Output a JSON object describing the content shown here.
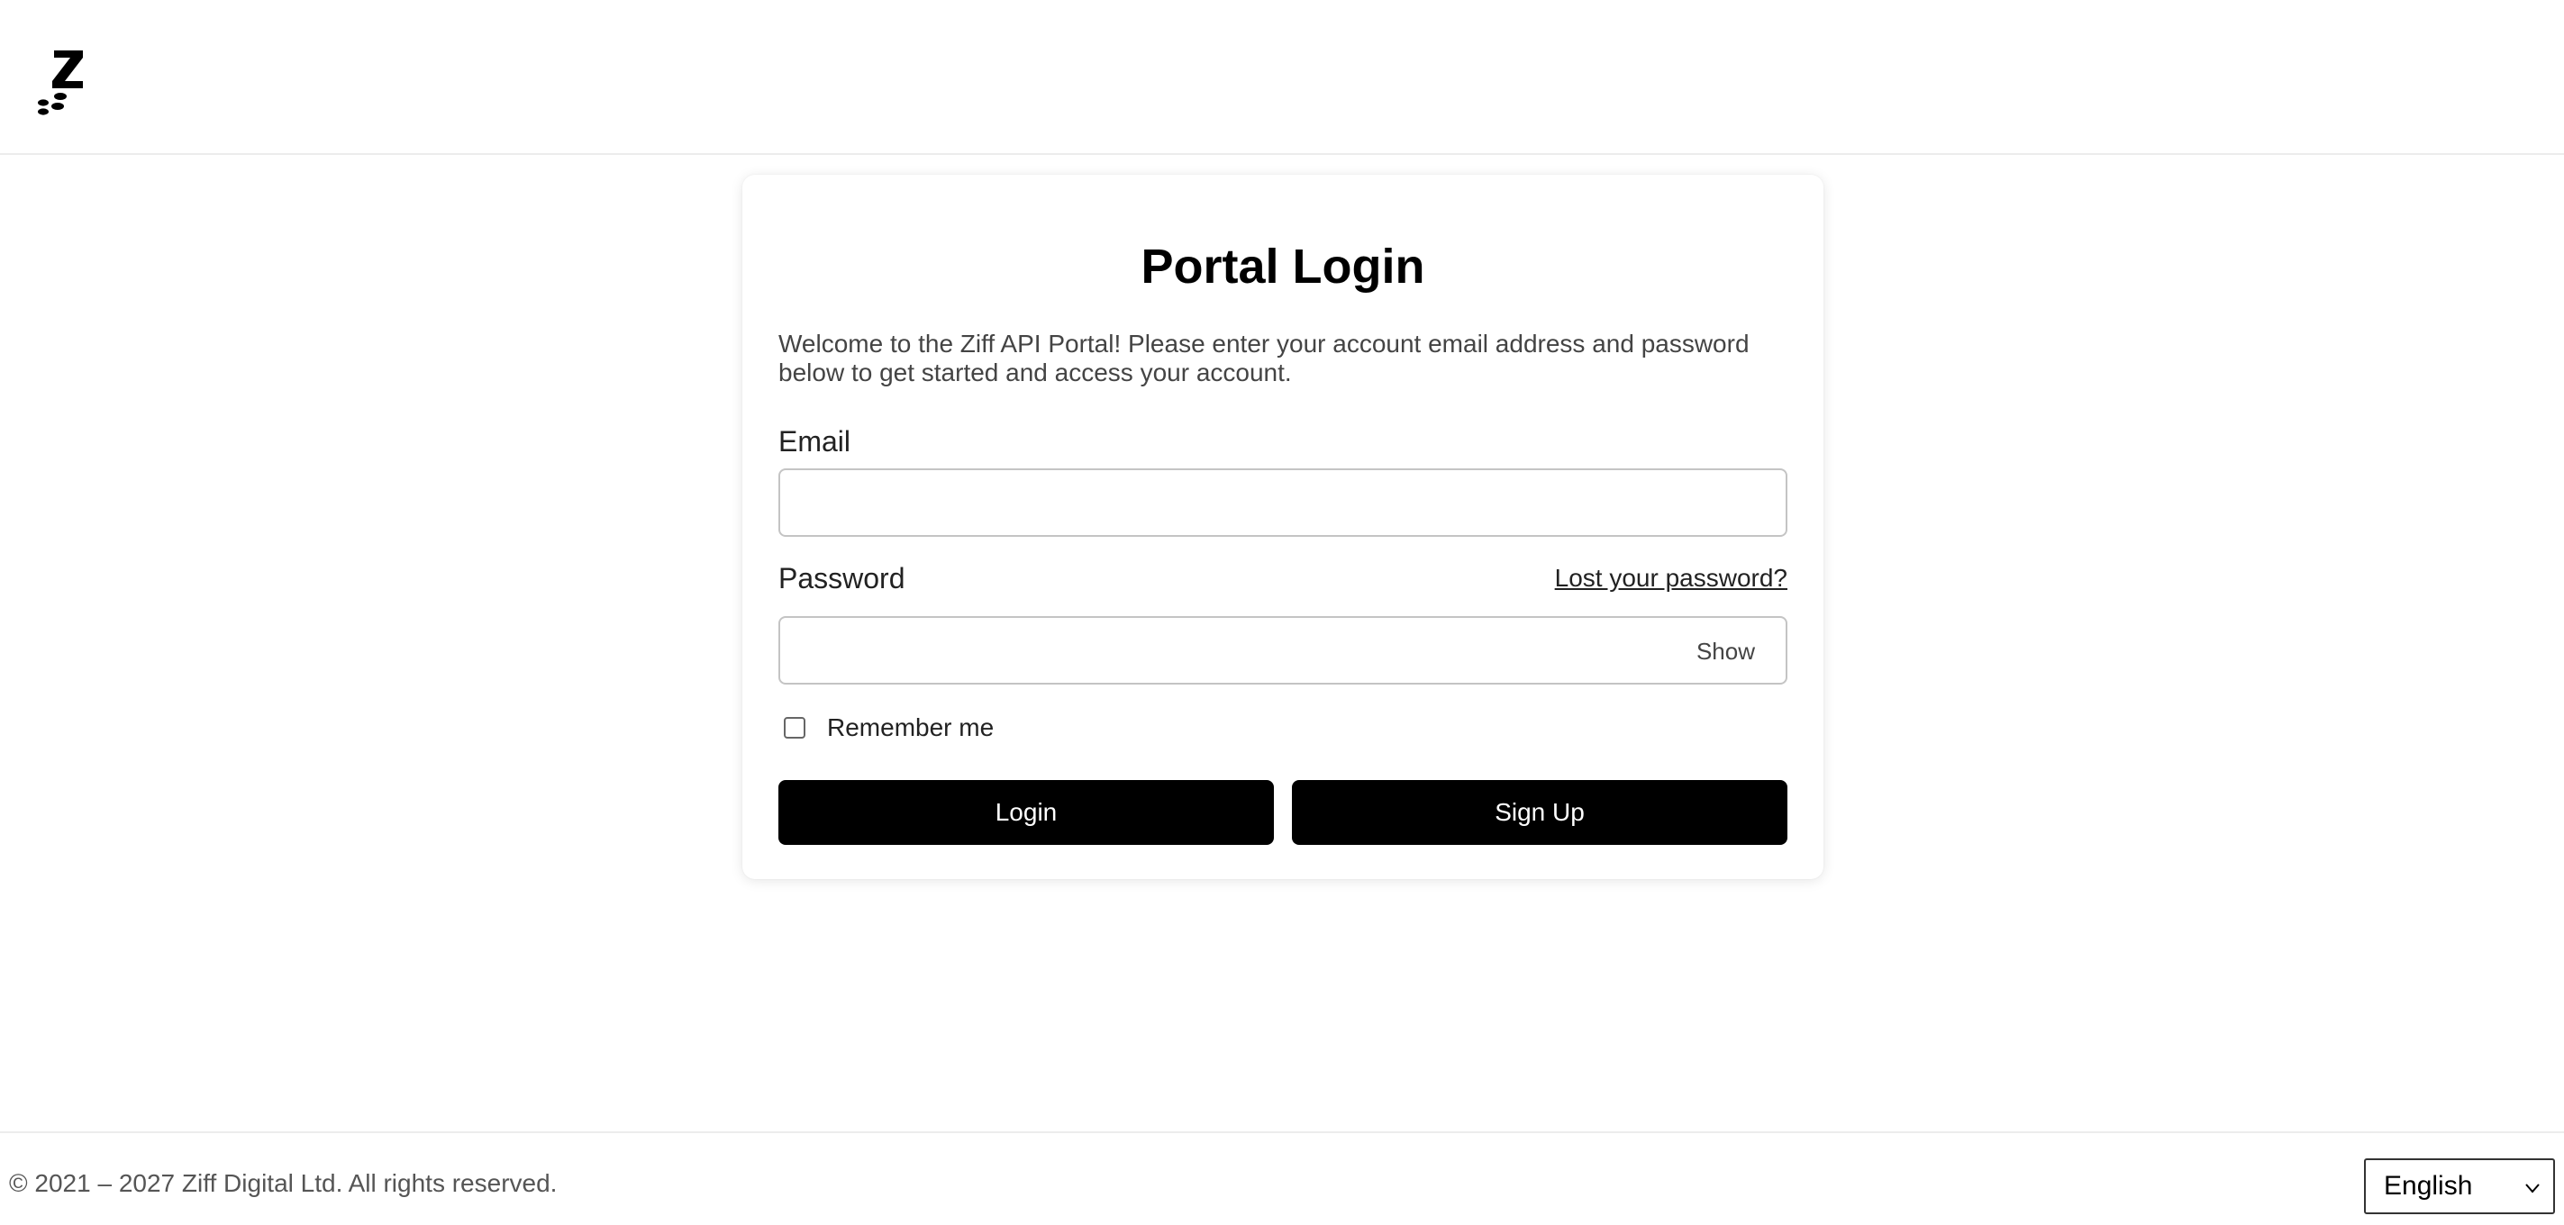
{
  "header": {
    "logo_icon": "ziff-z-logo-icon"
  },
  "login_card": {
    "title": "Portal Login",
    "intro": "Welcome to the Ziff API Portal! Please enter your account email address and password below to get started and access your account.",
    "email_label": "Email",
    "email_value": "",
    "password_label": "Password",
    "password_value": "",
    "lost_password_link": "Lost your password?",
    "show_label": "Show",
    "remember_label": "Remember me",
    "remember_checked": false,
    "login_button": "Login",
    "signup_button": "Sign Up"
  },
  "footer": {
    "copyright": "© 2021 – 2027 Ziff Digital Ltd. All rights reserved.",
    "language_selected": "English"
  },
  "colors": {
    "button_bg": "#000000",
    "button_text": "#ffffff",
    "border": "#c4c4c4"
  }
}
